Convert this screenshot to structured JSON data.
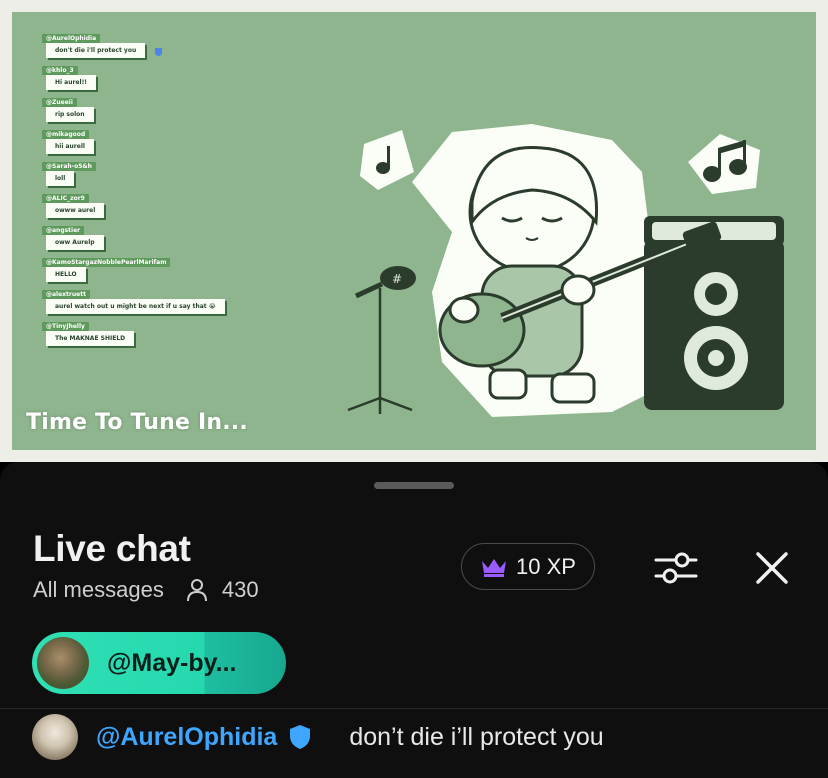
{
  "stream": {
    "title_overlay": "Time To Tune In...",
    "overlay_chat": [
      {
        "author": "@AurelOphidia",
        "text": "don't die i'll protect you",
        "verified": true
      },
      {
        "author": "@khlo_3",
        "text": "Hi aurel!!"
      },
      {
        "author": "@Zueeii",
        "text": "rip solon"
      },
      {
        "author": "@mikagood",
        "text": "hii aurell"
      },
      {
        "author": "@Sarah-o5&h",
        "text": "loll"
      },
      {
        "author": "@ALIC_zor9",
        "text": "owww aurel"
      },
      {
        "author": "@angstier",
        "text": "oww Aurelp"
      },
      {
        "author": "@KamoStargazNobblePearlMarifam",
        "text": "HELLO"
      },
      {
        "author": "@alextruett",
        "text": "aurel watch out u might be next if u say that 😭"
      },
      {
        "author": "@TinyJhelly",
        "text": "The MAKNAE SHIELD"
      }
    ]
  },
  "sheet": {
    "title": "Live chat",
    "filter_label": "All messages",
    "viewer_count": "430",
    "xp_label": "10 XP",
    "icons": {
      "viewer": "person-icon",
      "crown": "crown-icon",
      "filter": "sliders-icon",
      "close": "close-icon",
      "verified": "shield-icon"
    }
  },
  "pinned_chip": {
    "label": "@May-by..."
  },
  "message": {
    "author": "@AurelOphidia",
    "text": "don’t die i’ll protect you"
  },
  "colors": {
    "accent_teal": "#2fe0b4",
    "author_blue": "#3ea6ff",
    "crown_purple": "#9b5cff",
    "stream_green": "#8fb58e"
  }
}
